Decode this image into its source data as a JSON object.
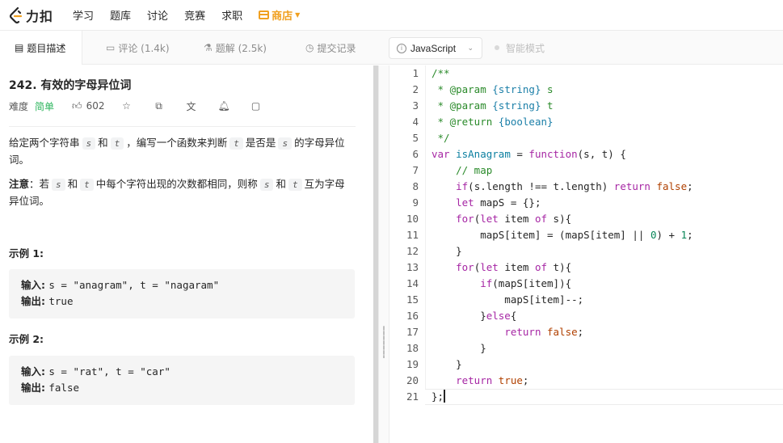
{
  "nav": {
    "brand": "力扣",
    "items": [
      "学习",
      "题库",
      "讨论",
      "竞赛",
      "求职"
    ],
    "store": "商店"
  },
  "tabs": {
    "description": "题目描述",
    "comments": "评论 (1.4k)",
    "solutions": "题解 (2.5k)",
    "submissions": "提交记录"
  },
  "editor_bar": {
    "language": "JavaScript",
    "smart_mode": "智能模式"
  },
  "problem": {
    "title": "242. 有效的字母异位词",
    "difficulty_label": "难度",
    "difficulty": "简单",
    "likes": "602",
    "desc_prefix": "给定两个字符串",
    "var_s": "s",
    "and": "和",
    "var_t": "t",
    "desc_mid": "，编写一个函数来判断",
    "desc_mid2": "是否是",
    "desc_suffix": "的字母异位词。",
    "note_label": "注意",
    "note_colon": "：若",
    "note_mid": "中每个字符出现的次数都相同，则称",
    "note_suffix": "互为字母异位词。",
    "example1_title": "示例 1:",
    "example1_input_label": "输入",
    "example1_input": "s = \"anagram\", t = \"nagaram\"",
    "example1_output_label": "输出",
    "example1_output": "true",
    "example2_title": "示例 2:",
    "example2_input_label": "输入",
    "example2_input": "s = \"rat\", t = \"car\"",
    "example2_output_label": "输出",
    "example2_output": "false"
  },
  "code_lines": [
    "/**",
    " * @param {string} s",
    " * @param {string} t",
    " * @return {boolean}",
    " */",
    "var isAnagram = function(s, t) {",
    "    // map",
    "    if(s.length !== t.length) return false;",
    "    let mapS = {};",
    "    for(let item of s){",
    "        mapS[item] = (mapS[item] || 0) + 1;",
    "    }",
    "    for(let item of t){",
    "        if(mapS[item]){",
    "            mapS[item]--;",
    "        }else{",
    "            return false;",
    "        }",
    "    }",
    "    return true;",
    "};"
  ],
  "line_numbers": [
    "1",
    "2",
    "3",
    "4",
    "5",
    "6",
    "7",
    "8",
    "9",
    "10",
    "11",
    "12",
    "13",
    "14",
    "15",
    "16",
    "17",
    "18",
    "19",
    "20",
    "21"
  ]
}
